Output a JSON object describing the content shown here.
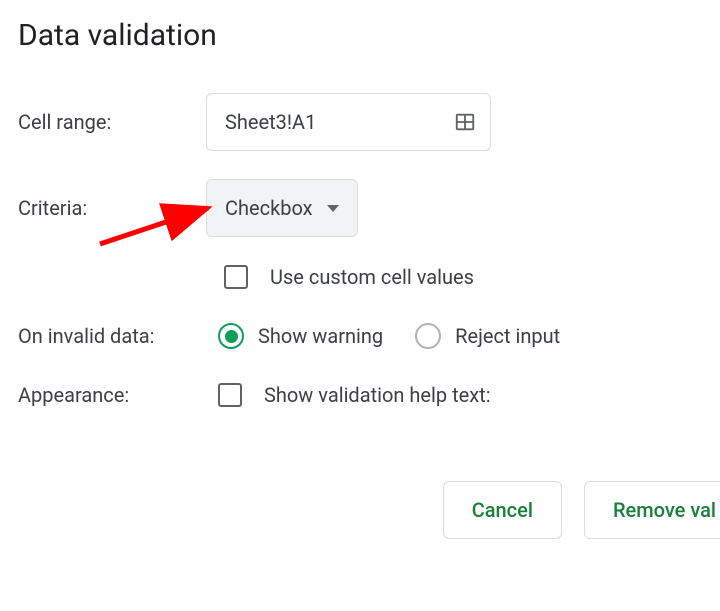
{
  "dialog": {
    "title": "Data validation"
  },
  "cellRange": {
    "label": "Cell range:",
    "value": "Sheet3!A1"
  },
  "criteria": {
    "label": "Criteria:",
    "dropdownValue": "Checkbox",
    "customValuesLabel": "Use custom cell values"
  },
  "invalidData": {
    "label": "On invalid data:",
    "showWarning": "Show warning",
    "rejectInput": "Reject input"
  },
  "appearance": {
    "label": "Appearance:",
    "helpTextLabel": "Show validation help text:"
  },
  "buttons": {
    "cancel": "Cancel",
    "removeValidation": "Remove val"
  }
}
